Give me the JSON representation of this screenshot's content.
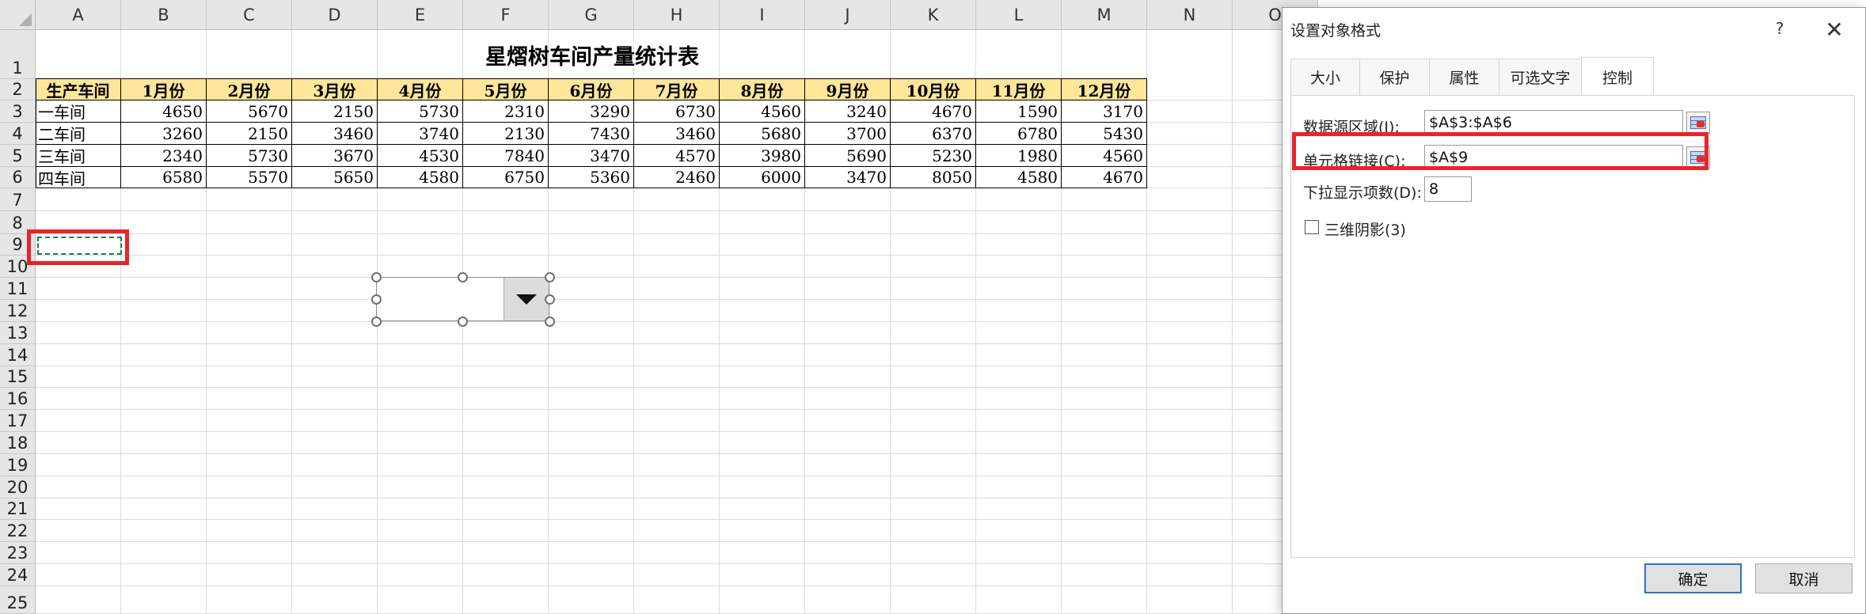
{
  "sheet": {
    "columns": [
      "A",
      "B",
      "C",
      "D",
      "E",
      "F",
      "G",
      "H",
      "I",
      "J",
      "K",
      "L",
      "M",
      "N",
      "O"
    ],
    "rows": [
      "1",
      "2",
      "3",
      "4",
      "5",
      "6",
      "7",
      "8",
      "9",
      "10",
      "11",
      "12",
      "13",
      "14",
      "15",
      "16",
      "17",
      "18",
      "19",
      "20",
      "21",
      "22",
      "23",
      "24",
      "25"
    ],
    "title": "星熠树车间产量统计表",
    "table": {
      "headers": [
        "生产车间",
        "1月份",
        "2月份",
        "3月份",
        "4月份",
        "5月份",
        "6月份",
        "7月份",
        "8月份",
        "9月份",
        "10月份",
        "11月份",
        "12月份"
      ],
      "rows": [
        [
          "一车间",
          "4650",
          "5670",
          "2150",
          "5730",
          "2310",
          "3290",
          "6730",
          "4560",
          "3240",
          "4670",
          "1590",
          "3170"
        ],
        [
          "二车间",
          "3260",
          "2150",
          "3460",
          "3740",
          "2130",
          "7430",
          "3460",
          "5680",
          "3700",
          "6370",
          "6780",
          "5430"
        ],
        [
          "三车间",
          "2340",
          "5730",
          "3670",
          "4530",
          "7840",
          "3470",
          "4570",
          "3980",
          "5690",
          "5230",
          "1980",
          "4560"
        ],
        [
          "四车间",
          "6580",
          "5570",
          "5650",
          "4580",
          "6750",
          "5360",
          "2460",
          "6000",
          "3470",
          "8050",
          "4580",
          "4670"
        ]
      ]
    },
    "header_fill": "#ffe699",
    "highlight_color": "#e8242b"
  },
  "dialog": {
    "title": "设置对象格式",
    "help": "?",
    "close": "✕",
    "tabs": [
      "大小",
      "保护",
      "属性",
      "可选文字",
      "控制"
    ],
    "active_tab": "控制",
    "fields": {
      "source_label": "数据源区域(I):",
      "source_value": "$A$3:$A$6",
      "link_label": "单元格链接(C):",
      "link_value": "$A$9",
      "dropdown_label": "下拉显示项数(D):",
      "dropdown_value": "8",
      "shading_label": "三维阴影(3)"
    },
    "ok": "确定",
    "cancel": "取消"
  }
}
